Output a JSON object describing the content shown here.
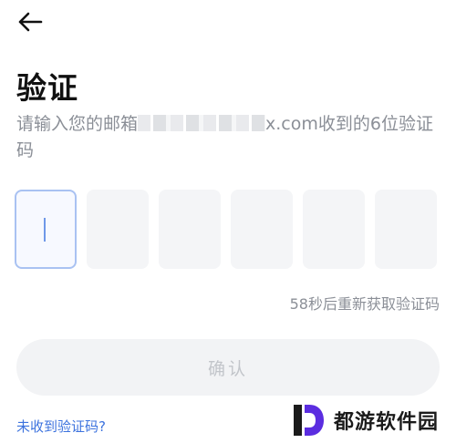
{
  "header": {
    "back_icon": "arrow-left-icon"
  },
  "title": "验证",
  "subtitle": {
    "prefix": "请输入您的邮箱",
    "masked_email_tail": "x.com",
    "suffix": "收到的6位验证码"
  },
  "code": {
    "length": 6,
    "values": [
      "",
      "",
      "",
      "",
      "",
      ""
    ],
    "active_index": 0
  },
  "resend_text": "58秒后重新获取验证码",
  "confirm_label": "确认",
  "help_link": "未收到验证码?",
  "watermark": {
    "text": "都游软件园",
    "logo_icon": "d-logo-icon"
  },
  "colors": {
    "accent": "#3d73de",
    "active_border": "#a9c2f2",
    "box_bg": "#f4f5f7",
    "muted_text": "#8b8f97",
    "button_bg": "#f2f3f5",
    "button_text": "#c2c5ca"
  }
}
